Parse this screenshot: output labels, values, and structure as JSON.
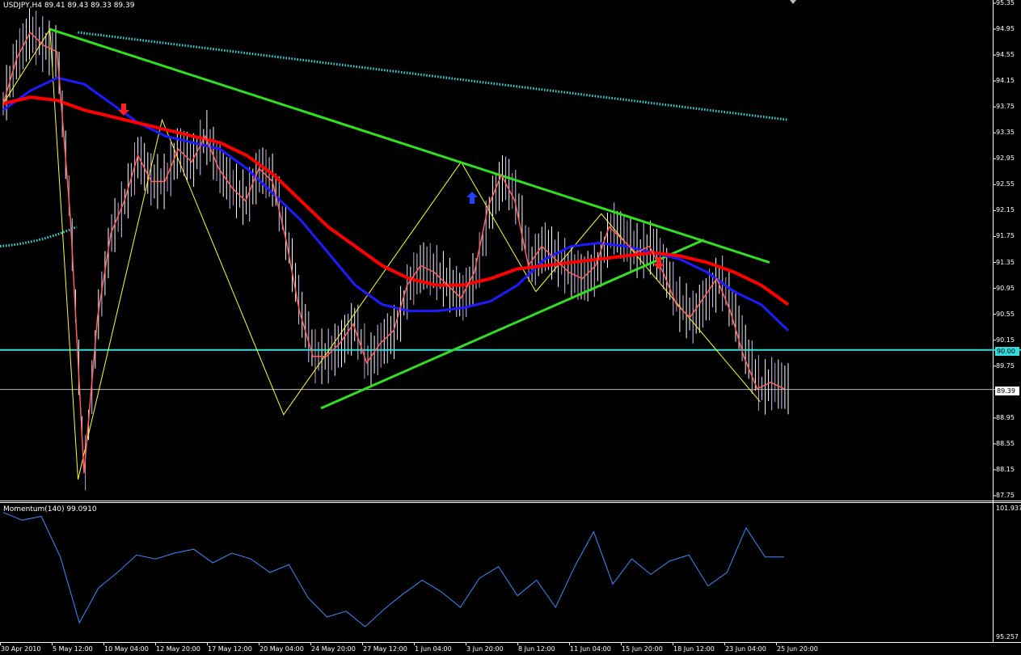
{
  "header": {
    "symbol_line": "USDJPY,H4  89.41 89.43 89.33 89.39"
  },
  "indicator": {
    "title": "Momentum(140) 99.0910",
    "max_label": "101.937",
    "min_label": "95.257"
  },
  "price_axis": {
    "ticks": [
      "95.35",
      "94.95",
      "94.55",
      "94.15",
      "93.75",
      "93.35",
      "92.95",
      "92.55",
      "92.15",
      "91.75",
      "91.35",
      "90.95",
      "90.55",
      "90.15",
      "89.75",
      "88.95",
      "88.55",
      "88.15",
      "87.75"
    ],
    "level_label": "90.00",
    "current_label": "89.39"
  },
  "time_axis": {
    "ticks": [
      "30 Apr 2010",
      "5 May 12:00",
      "10 May 04:00",
      "12 May 20:00",
      "17 May 12:00",
      "20 May 04:00",
      "24 May 20:00",
      "27 May 12:00",
      "1 Jun 04:00",
      "3 Jun 20:00",
      "8 Jun 12:00",
      "11 Jun 04:00",
      "15 Jun 20:00",
      "18 Jun 12:00",
      "23 Jun 04:00",
      "25 Jun 20:00"
    ]
  },
  "colors": {
    "background": "#000000",
    "ma_fast": "#ff0000",
    "ma_slow": "#1c1cff",
    "close_line": "#ff6060",
    "trend": "#33dd22",
    "zigzag": "#ffff33",
    "level": "#33dddd",
    "momentum": "#3a8cff"
  },
  "chart_data": {
    "type": "line",
    "title": "",
    "ylim": [
      87.55,
      95.5
    ],
    "close": [
      93.8,
      94.5,
      94.9,
      94.7,
      94.6,
      92.0,
      88.1,
      90.5,
      91.8,
      92.3,
      93.0,
      92.6,
      92.6,
      93.1,
      92.9,
      93.3,
      92.8,
      92.5,
      92.3,
      92.8,
      92.6,
      91.7,
      90.6,
      89.9,
      89.9,
      90.1,
      90.4,
      89.8,
      90.1,
      90.3,
      91.0,
      91.3,
      91.2,
      91.0,
      90.8,
      91.2,
      92.2,
      92.7,
      92.3,
      91.3,
      91.6,
      91.4,
      91.2,
      91.1,
      91.3,
      91.9,
      91.7,
      91.5,
      91.6,
      91.2,
      90.7,
      90.5,
      90.8,
      91.1,
      90.6,
      89.9,
      89.4,
      89.5,
      89.4
    ],
    "ma_fast": [
      93.8,
      93.9,
      93.85,
      93.7,
      93.6,
      93.5,
      93.4,
      93.3,
      93.2,
      93.0,
      92.7,
      92.3,
      91.9,
      91.6,
      91.3,
      91.1,
      91.0,
      91.0,
      91.1,
      91.25,
      91.3,
      91.35,
      91.4,
      91.45,
      91.5,
      91.45,
      91.35,
      91.2,
      91.0,
      90.7
    ],
    "ma_slow": [
      93.7,
      94.0,
      94.2,
      94.1,
      93.8,
      93.5,
      93.3,
      93.2,
      93.1,
      92.8,
      92.4,
      92.0,
      91.5,
      91.0,
      90.7,
      90.6,
      90.6,
      90.65,
      90.75,
      91.0,
      91.4,
      91.6,
      91.65,
      91.6,
      91.5,
      91.4,
      91.2,
      90.9,
      90.7,
      90.3
    ],
    "zigzag": [
      [
        0,
        93.8
      ],
      [
        5,
        94.95
      ],
      [
        8,
        88.0
      ],
      [
        17,
        93.55
      ],
      [
        30,
        89.0
      ],
      [
        49,
        92.9
      ],
      [
        57,
        90.9
      ],
      [
        64,
        92.1
      ],
      [
        81,
        89.2
      ]
    ],
    "trend_upper": [
      [
        5,
        94.95
      ],
      [
        82,
        91.35
      ]
    ],
    "trend_lower": [
      [
        34,
        89.1
      ],
      [
        75,
        91.7
      ]
    ],
    "channel": [
      [
        8,
        94.9
      ],
      [
        84,
        93.55
      ]
    ],
    "level": 90.0,
    "current": 89.39,
    "momentum": [
      101.7,
      101.3,
      101.5,
      99.4,
      96.0,
      97.8,
      98.6,
      99.5,
      99.3,
      99.6,
      99.8,
      99.1,
      99.6,
      99.3,
      98.6,
      99.0,
      97.3,
      96.3,
      96.6,
      95.8,
      96.7,
      97.5,
      98.2,
      97.6,
      96.8,
      98.3,
      98.9,
      97.4,
      98.2,
      96.8,
      98.9,
      100.7,
      98.0,
      99.3,
      98.5,
      99.2,
      99.5,
      97.9,
      98.6,
      100.9,
      99.4,
      99.4
    ]
  }
}
